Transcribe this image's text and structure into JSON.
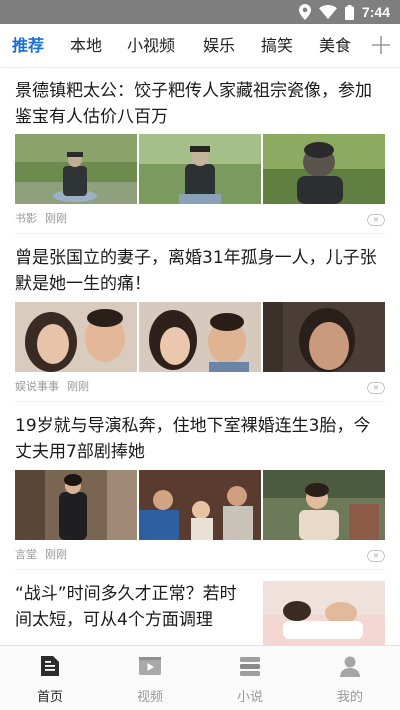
{
  "status_bar": {
    "time": "7:44"
  },
  "channels": {
    "tabs": [
      {
        "label": "推荐",
        "active": true
      },
      {
        "label": "本地"
      },
      {
        "label": "小视频"
      },
      {
        "label": "娱乐"
      },
      {
        "label": "搞笑"
      },
      {
        "label": "美食"
      }
    ],
    "add_icon": "plus-icon"
  },
  "feed": {
    "articles": [
      {
        "title": "景德镇粑太公：饺子粑传人家藏祖宗瓷像，参加鉴宝有人估价八百万",
        "source": "书影",
        "time": "刚刚",
        "images": [
          "ancestor-statue-photo",
          "ancestor-statue-photo",
          "ancestor-statue-closeup-photo"
        ]
      },
      {
        "title": "曾是张国立的妻子，离婚31年孤身一人，儿子张默是她一生的痛！",
        "source": "娱说事事",
        "time": "刚刚",
        "images": [
          "family-portrait-photo",
          "family-portrait-photo",
          "actress-closeup-photo"
        ]
      },
      {
        "title": "19岁就与导演私奔，住地下室裸婚连生3胎，今丈夫用7部剧捧她",
        "source": "言堂",
        "time": "刚刚",
        "images": [
          "actress-street-photo",
          "family-with-baby-photo",
          "drama-scene-photo"
        ]
      },
      {
        "title": "“战斗”时间多久才正常？若时间太短，可从4个方面调理",
        "images": [
          "couple-in-bed-photo"
        ]
      }
    ],
    "dismiss_glyph": "×"
  },
  "bottom_nav": {
    "items": [
      {
        "label": "首页",
        "icon": "home-document-icon",
        "active": true
      },
      {
        "label": "视频",
        "icon": "video-play-icon"
      },
      {
        "label": "小说",
        "icon": "novel-book-icon"
      },
      {
        "label": "我的",
        "icon": "user-profile-icon"
      }
    ]
  },
  "colors": {
    "accent": "#1b6ed8",
    "status_bar": "#7f7f7f",
    "meta_text": "#999999"
  }
}
